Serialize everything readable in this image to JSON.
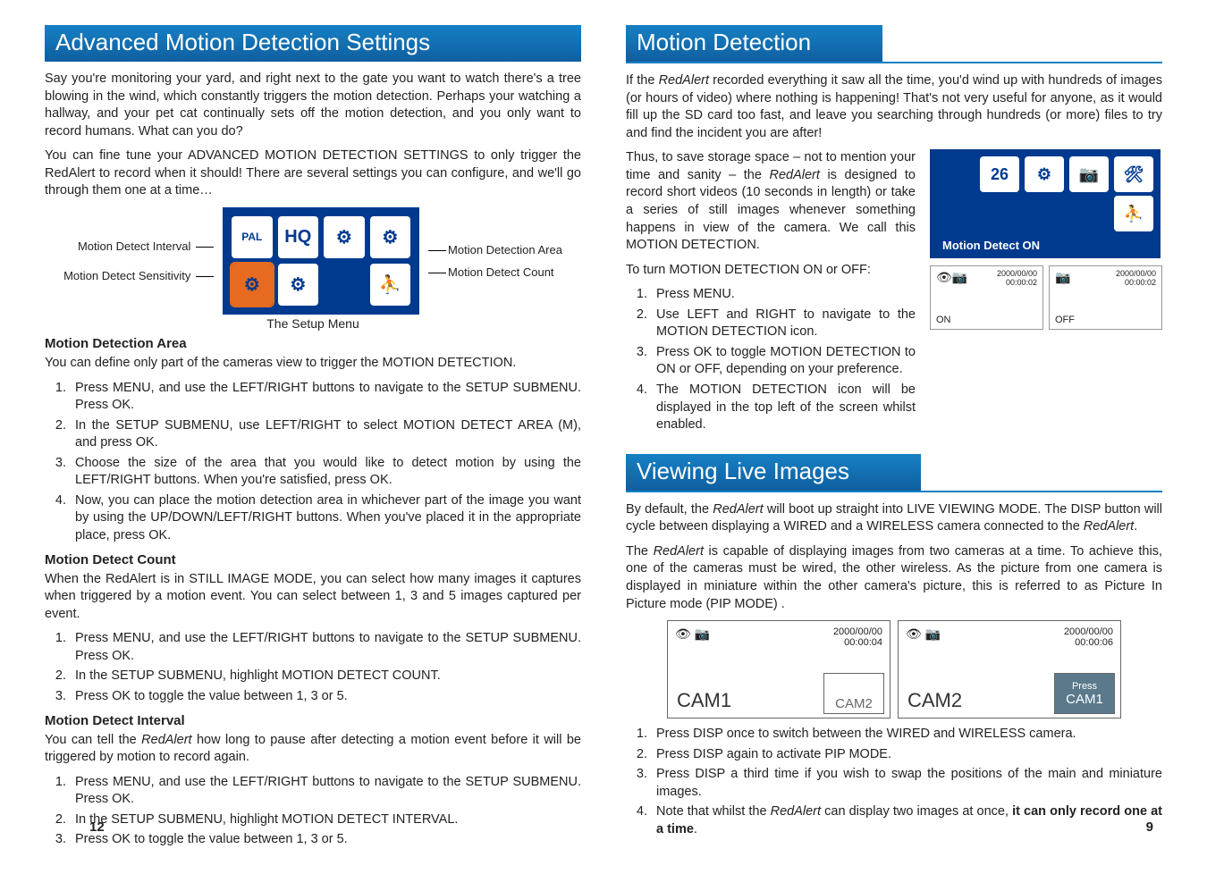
{
  "left": {
    "header": "Advanced Motion Detection Settings",
    "intro_p1": "Say you're monitoring your yard, and right next to the gate you want to watch there's a tree blowing in the wind, which constantly triggers the motion detection. Perhaps your watching a hallway, and your pet cat continually sets off the motion detection, and you only want to record humans. What can you do?",
    "intro_p2": "You can fine tune your ADVANCED MOTION DETECTION SETTINGS to only trigger the RedAlert to record when it should! There are several settings you can configure, and we'll go through them one at a time…",
    "fig_labels": {
      "left1": "Motion Detect Interval",
      "left2": "Motion Detect Sensitivity",
      "right1": "Motion Detection Area",
      "right2": "Motion Detect Count",
      "caption": "The Setup Menu"
    },
    "area_head": "Motion Detection Area",
    "area_p": "You can define only part of the cameras view to trigger the MOTION DETECTION.",
    "area_steps": [
      "Press MENU, and use the LEFT/RIGHT buttons to navigate to the SETUP SUBMENU. Press OK.",
      "In the SETUP SUBMENU, use LEFT/RIGHT to select MOTION DETECT AREA (M), and press OK.",
      "Choose the size of the area that you would like to detect motion by using the LEFT/RIGHT buttons. When you're satisfied, press OK.",
      "Now, you can place the motion detection area in whichever part of the image you want by using the UP/DOWN/LEFT/RIGHT buttons. When you've placed it in the appropriate place, press OK."
    ],
    "count_head": "Motion Detect Count",
    "count_p": "When the RedAlert is in STILL IMAGE MODE, you can select how many images it captures when triggered by a motion event.  You can select between 1, 3 and 5 images captured per event.",
    "count_steps": [
      "Press MENU, and use the LEFT/RIGHT buttons to navigate to the SETUP SUBMENU. Press OK.",
      "In the SETUP SUBMENU, highlight MOTION DETECT COUNT.",
      "Press OK to toggle the value between 1, 3 or 5."
    ],
    "interval_head": "Motion Detect Interval",
    "interval_p": "You can tell the RedAlert how long to pause after detecting a motion event before it will be triggered by motion to record again.",
    "interval_steps": [
      "Press MENU, and use the LEFT/RIGHT buttons to navigate to the SETUP SUBMENU. Press OK.",
      "In the SETUP SUBMENU, highlight MOTION DETECT INTERVAL.",
      "Press OK to toggle the value between 1, 3 or 5."
    ],
    "page_num": "12"
  },
  "right": {
    "md_header": "Motion Detection",
    "md_p1": "If the RedAlert recorded everything it saw all the time, you'd wind up with hundreds of images (or hours of video) where nothing is happening! That's not very useful for anyone, as it would fill up the SD card too fast, and leave you searching through hundreds (or more) files to try and find the incident you are after!",
    "md_p2_a": "Thus, to save storage space – not to mention your time and sanity – the ",
    "md_p2_b": " is designed to record short videos (10 seconds in length) or take a series of still images whenever something happens in view of the camera. We call this MOTION DETECTION.",
    "md_p3": "To turn MOTION DETECTION ON or OFF:",
    "md_steps": [
      "Press MENU.",
      "Use LEFT and RIGHT to navigate to the MOTION DETECTION icon.",
      "Press OK to toggle MOTION DETECTION to ON or OFF, depending on your preference.",
      "The MOTION DETECTION icon will be displayed in the top left of the screen whilst enabled."
    ],
    "md_screen_text": "Motion Detect  ON",
    "status_ts": "2000/00/00",
    "status_time": "00:00:02",
    "status_on": "ON",
    "status_off": "OFF",
    "vi_header": "Viewing Live Images",
    "vi_p1_a": "By default, the ",
    "vi_p1_b": " will boot up straight into LIVE VIEWING MODE. The DISP button will cycle between displaying a WIRED and a WIRELESS camera connected to the ",
    "vi_p2_a": "The ",
    "vi_p2_b": " is capable of displaying images from two cameras at a time. To achieve this, one of the cameras must be wired, the other wireless.  As the picture from one camera is displayed in miniature within the other camera's picture, this is referred to as Picture In Picture mode (PIP MODE) .",
    "pip1_ts": "2000/00/00",
    "pip1_time": "00:00:04",
    "pip1_main": "CAM1",
    "pip1_sub": "CAM2",
    "pip2_ts": "2000/00/00",
    "pip2_time": "00:00:06",
    "pip2_main": "CAM2",
    "pip2_press": "Press",
    "pip2_sub": "CAM1",
    "vi_steps": [
      "Press DISP once to switch between the WIRED and WIRELESS camera.",
      "Press DISP again to activate PIP MODE.",
      "Press DISP a third time if you wish to swap the positions of the main and miniature images."
    ],
    "vi_step4_a": "Note that whilst the ",
    "vi_step4_b": " can display two images at once, ",
    "vi_step4_c": "it can only record one at a time",
    "product": "RedAlert",
    "page_num": "9"
  },
  "icons": {
    "cal26": "26",
    "gear": "⚙",
    "pal": "PAL",
    "hq": "HQ",
    "gearM": "⚙",
    "gearN": "⚙",
    "person": "⛹"
  }
}
